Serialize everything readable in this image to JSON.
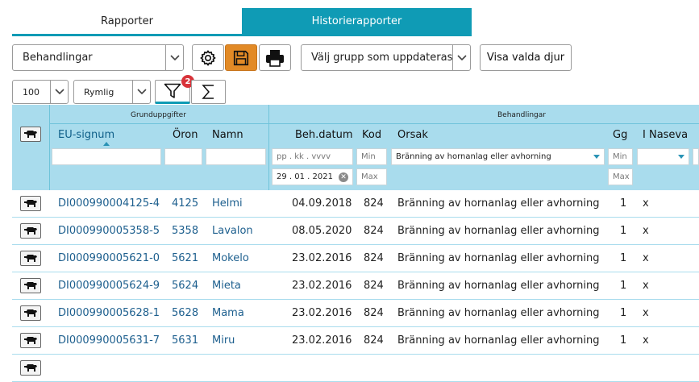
{
  "tabs": [
    {
      "label": "Rapporter",
      "active": false
    },
    {
      "label": "Historierapporter",
      "active": true
    }
  ],
  "toolbar": {
    "report_select": "Behandlingar",
    "group_select": "Välj grupp som uppdateras",
    "show_selected_label": "Visa valda djur",
    "page_size": "100",
    "density": "Rymlig",
    "filter_count": "2",
    "icons": [
      "gear-icon",
      "save-icon",
      "print-icon",
      "filter-icon",
      "sum-icon"
    ]
  },
  "header": {
    "group1": "Grunduppgifter",
    "group2": "Behandlingar",
    "columns": [
      "EU-signum",
      "Öron",
      "Namn",
      "Beh.datum",
      "Kod",
      "Orsak",
      "Gg",
      "I Naseva"
    ]
  },
  "filters": {
    "date_placeholder": "pp . kk . vvvv",
    "date_value": "29 . 01 . 2021",
    "min": "Min",
    "max": "Max",
    "orsak_value": "Bränning av hornanlag eller avhorning"
  },
  "rows": [
    {
      "eu": "DI000990004125-4",
      "oron": "4125",
      "namn": "Helmi",
      "datum": "04.09.2018",
      "kod": "824",
      "orsak": "Bränning av hornanlag eller avhorning",
      "gg": "1",
      "naseva": "x"
    },
    {
      "eu": "DI000990005358-5",
      "oron": "5358",
      "namn": "Lavalon",
      "datum": "08.05.2020",
      "kod": "824",
      "orsak": "Bränning av hornanlag eller avhorning",
      "gg": "1",
      "naseva": "x"
    },
    {
      "eu": "DI000990005621-0",
      "oron": "5621",
      "namn": "Mokelo",
      "datum": "23.02.2016",
      "kod": "824",
      "orsak": "Bränning av hornanlag eller avhorning",
      "gg": "1",
      "naseva": "x"
    },
    {
      "eu": "DI000990005624-9",
      "oron": "5624",
      "namn": "Mieta",
      "datum": "23.02.2016",
      "kod": "824",
      "orsak": "Bränning av hornanlag eller avhorning",
      "gg": "1",
      "naseva": "x"
    },
    {
      "eu": "DI000990005628-1",
      "oron": "5628",
      "namn": "Mama",
      "datum": "23.02.2016",
      "kod": "824",
      "orsak": "Bränning av hornanlag eller avhorning",
      "gg": "1",
      "naseva": "x"
    },
    {
      "eu": "DI000990005631-7",
      "oron": "5631",
      "namn": "Miru",
      "datum": "23.02.2016",
      "kod": "824",
      "orsak": "Bränning av hornanlag eller avhorning",
      "gg": "1",
      "naseva": "x"
    }
  ],
  "colors": {
    "accent": "#0f9bb5",
    "header_bg": "#a9dced",
    "save_orange": "#e28a26",
    "badge_red": "#d8333a",
    "link": "#1d5f8e"
  }
}
